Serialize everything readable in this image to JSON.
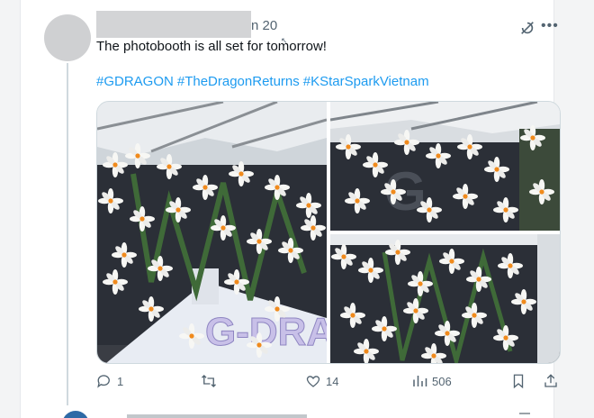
{
  "post": {
    "date": "n 20",
    "text": "The photobooth is all set for tomorrow!",
    "hashtags": [
      "#GDRAGON",
      "#TheDragonReturns",
      "#KStarSparkVietnam"
    ]
  },
  "actions": {
    "replies": "1",
    "retweets": "",
    "likes": "14",
    "views": "506"
  },
  "icons": [
    "grok-icon",
    "more-icon",
    "reply-icon",
    "retweet-icon",
    "like-icon",
    "views-icon",
    "bookmark-icon",
    "share-icon"
  ],
  "colors": {
    "link": "#1d9bf0",
    "muted": "#536471",
    "text": "#0f1419",
    "flower_center": "#f08a1c"
  },
  "media": {
    "images": [
      {
        "description_id": "photo-1",
        "logo_text": "G-DRA"
      },
      {
        "description_id": "photo-2"
      },
      {
        "description_id": "photo-3"
      }
    ]
  }
}
